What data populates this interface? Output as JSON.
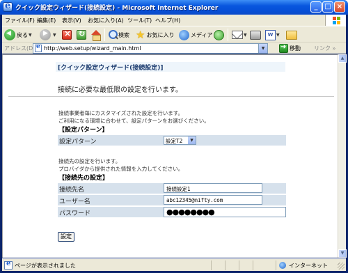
{
  "window": {
    "title": "クイック設定ウィザード(接続設定) - Microsoft Internet Explorer",
    "min_label": "_",
    "max_label": "□",
    "close_label": "×"
  },
  "menubar": {
    "items": [
      {
        "label": "ファイル(F)"
      },
      {
        "label": "編集(E)"
      },
      {
        "label": "表示(V)"
      },
      {
        "label": "お気に入り(A)"
      },
      {
        "label": "ツール(T)"
      },
      {
        "label": "ヘルプ(H)"
      }
    ]
  },
  "toolbar": {
    "back_label": "戻る",
    "search_label": "検索",
    "favorites_label": "お気に入り",
    "media_label": "メディア"
  },
  "address": {
    "label": "アドレス(D)",
    "url": "http://web.setup/wizard_main.html",
    "go_label": "移動",
    "links_label": "リンク »"
  },
  "page": {
    "wizard_title": "[クイック設定ウィザード(接続設定)]",
    "description": "接続に必要な最低限の設定を行います。",
    "pattern_note_1": "接続事業者毎にカスタマイズされた設定を行います。",
    "pattern_note_2": "ご利用になる環境に合わせて、設定パターンをお選びください。",
    "pattern_section": "【設定パターン】",
    "pattern_label": "設定パターン",
    "pattern_selected": "設定T2",
    "dest_note_1": "接続先の設定を行います。",
    "dest_note_2": "プロバイダから提供された情報を入力してください。",
    "dest_section": "【接続先の設定】",
    "dest_name_label": "接続先名",
    "dest_name_value": "接続設定1",
    "username_label": "ユーザー名",
    "username_value": "abc12345@nifty.com",
    "password_label": "パスワード",
    "password_value": "●●●●●●●●",
    "submit_label": "設定"
  },
  "statusbar": {
    "status_text": "ページが表示されました",
    "zone_text": "インターネット"
  },
  "colors": {
    "titlebar": "#0856de",
    "chrome": "#ece9d8",
    "form_row": "#d6e1ec",
    "header_bg": "#eef5fb"
  }
}
